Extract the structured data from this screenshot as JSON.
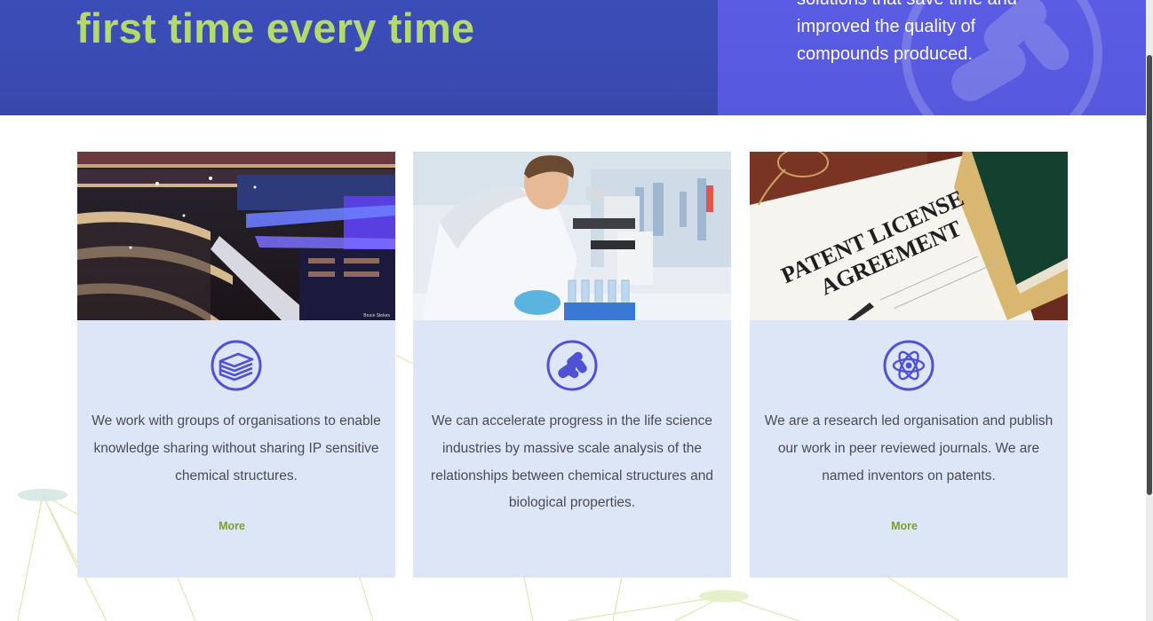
{
  "hero": {
    "title": "first time every time",
    "text_lines": [
      "solutions that save time and",
      "improved the quality of",
      "compounds produced."
    ]
  },
  "cards": [
    {
      "icon": "books-icon",
      "image": "library-photo",
      "photo_credit": "Bruce Stokes",
      "text_lines": [
        "We work with groups of organisations to enable",
        "knowledge sharing without sharing IP sensitive",
        "chemical structures."
      ],
      "more_label": "More"
    },
    {
      "icon": "pills-icon",
      "image": "scientist-microscope-photo",
      "text_lines": [
        "We can accelerate progress in the life science",
        "industries by massive scale analysis of the",
        "relationships between chemical structures and",
        "biological properties."
      ],
      "more_label": ""
    },
    {
      "icon": "atom-icon",
      "image": "patent-license-photo",
      "image_text": [
        "PATENT LICENSE",
        "AGREEMENT"
      ],
      "text_lines": [
        "We are a research led organisation and publish",
        "our work in peer reviewed journals. We are",
        "named inventors on patents."
      ],
      "more_label": "More"
    }
  ],
  "colors": {
    "hero_left": "#3b4db8",
    "hero_right": "#5a5de4",
    "title_green": "#b4da6e",
    "card_bg": "#dde6f7",
    "icon_purple": "#5151d6",
    "more_green": "#7aa12f"
  }
}
